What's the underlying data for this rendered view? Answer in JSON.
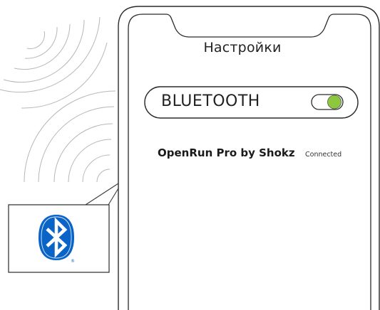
{
  "settings_screen": {
    "title": "Настройки",
    "bluetooth_toggle": {
      "label": "BLUETOOTH",
      "state": "on",
      "color": "#8dc63f"
    }
  },
  "paired_devices": [
    {
      "name": "OpenRun Pro by Shokz",
      "status": "Connected"
    }
  ],
  "callout": {
    "icon": "bluetooth-logo-icon",
    "mark": "®",
    "badge_color": "#0a64c8"
  },
  "illustration": {
    "signal_icon": "radio-waves-icon"
  }
}
